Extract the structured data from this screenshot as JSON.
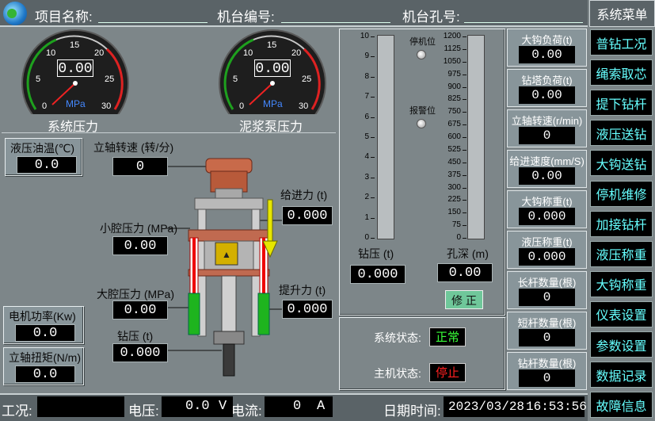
{
  "header": {
    "project_label": "项目名称:",
    "rig_no_label": "机台编号:",
    "hole_no_label": "机台孔号:",
    "menu_title": "系统菜单"
  },
  "menu": [
    "普钻工况",
    "绳索取芯",
    "提下钻杆",
    "液压送钻",
    "大钩送钻",
    "停机维修",
    "加接钻杆",
    "液压称重",
    "大钩称重",
    "仪表设置",
    "参数设置",
    "数据记录",
    "故障信息"
  ],
  "gauges": [
    {
      "label": "系统压力",
      "value": "0.00",
      "unit": "MPa",
      "ticks": [
        "0",
        "5",
        "10",
        "15",
        "20",
        "25",
        "30"
      ]
    },
    {
      "label": "泥浆泵压力",
      "value": "0.00",
      "unit": "MPa",
      "ticks": [
        "0",
        "5",
        "10",
        "15",
        "20",
        "25",
        "30"
      ]
    }
  ],
  "left": {
    "oil_temp_label": "液压油温(℃)",
    "oil_temp_value": "0.0",
    "motor_power_label": "电机功率(Kw)",
    "motor_power_value": "0.0",
    "shaft_torque_label": "立轴扭矩(N/m)",
    "shaft_torque_value": "0.0"
  },
  "rig": {
    "speed_label": "立轴转速 (转/分)",
    "speed_value": "0",
    "small_chamber_label": "小腔压力 (MPa)",
    "small_chamber_value": "0.00",
    "big_chamber_label": "大腔压力 (MPa)",
    "big_chamber_value": "0.00",
    "bit_pressure_label": "钻压 (t)",
    "bit_pressure_value": "0.000",
    "feed_force_label": "给进力 (t)",
    "feed_force_value": "0.000",
    "lift_force_label": "提升力 (t)",
    "lift_force_value": "0.000"
  },
  "bars": {
    "stop_label": "停机位",
    "alarm_label": "报警位",
    "pressure_ticks": [
      "10",
      "9",
      "8",
      "7",
      "6",
      "5",
      "4",
      "3",
      "2",
      "1",
      "0"
    ],
    "depth_ticks": [
      "1200",
      "1125",
      "1050",
      "975",
      "900",
      "825",
      "750",
      "675",
      "600",
      "525",
      "450",
      "375",
      "300",
      "225",
      "150",
      "75",
      "0"
    ],
    "pressure_label": "钻压 (t)",
    "pressure_value": "0.000",
    "depth_label": "孔深 (m)",
    "depth_value": "0.00",
    "correct_button": "修 正"
  },
  "status": {
    "system_label": "系统状态:",
    "system_value": "正常",
    "host_label": "主机状态:",
    "host_value": "停止"
  },
  "right_panels": [
    {
      "label": "大钩负荷(t)",
      "value": "0.00"
    },
    {
      "label": "钻塔负荷(t)",
      "value": "0.00"
    },
    {
      "label": "立轴转速(r/min)",
      "value": "0"
    },
    {
      "label": "给进速度(mm/S)",
      "value": "0.00"
    },
    {
      "label": "大钩称重(t)",
      "value": "0.000"
    },
    {
      "label": "液压称重(t)",
      "value": "0.000"
    },
    {
      "label": "长杆数量(根)",
      "value": "0"
    },
    {
      "label": "短杆数量(根)",
      "value": "0"
    },
    {
      "label": "钻杆数量(根)",
      "value": "0"
    }
  ],
  "footer": {
    "condition_label": "工况:",
    "condition_value": "",
    "voltage_label": "电压:",
    "voltage_value": "0.0",
    "voltage_unit": "V",
    "current_label": "电流:",
    "current_value": "0",
    "current_unit": "A",
    "datetime_label": "日期时间:",
    "date_value": "2023/03/28",
    "time_value": "16:53:56"
  },
  "colors": {
    "accent_green": "#39ff39",
    "alarm_red": "#ff2020",
    "menu_text": "#66ffff",
    "arrow_yellow": "#e6e600"
  }
}
